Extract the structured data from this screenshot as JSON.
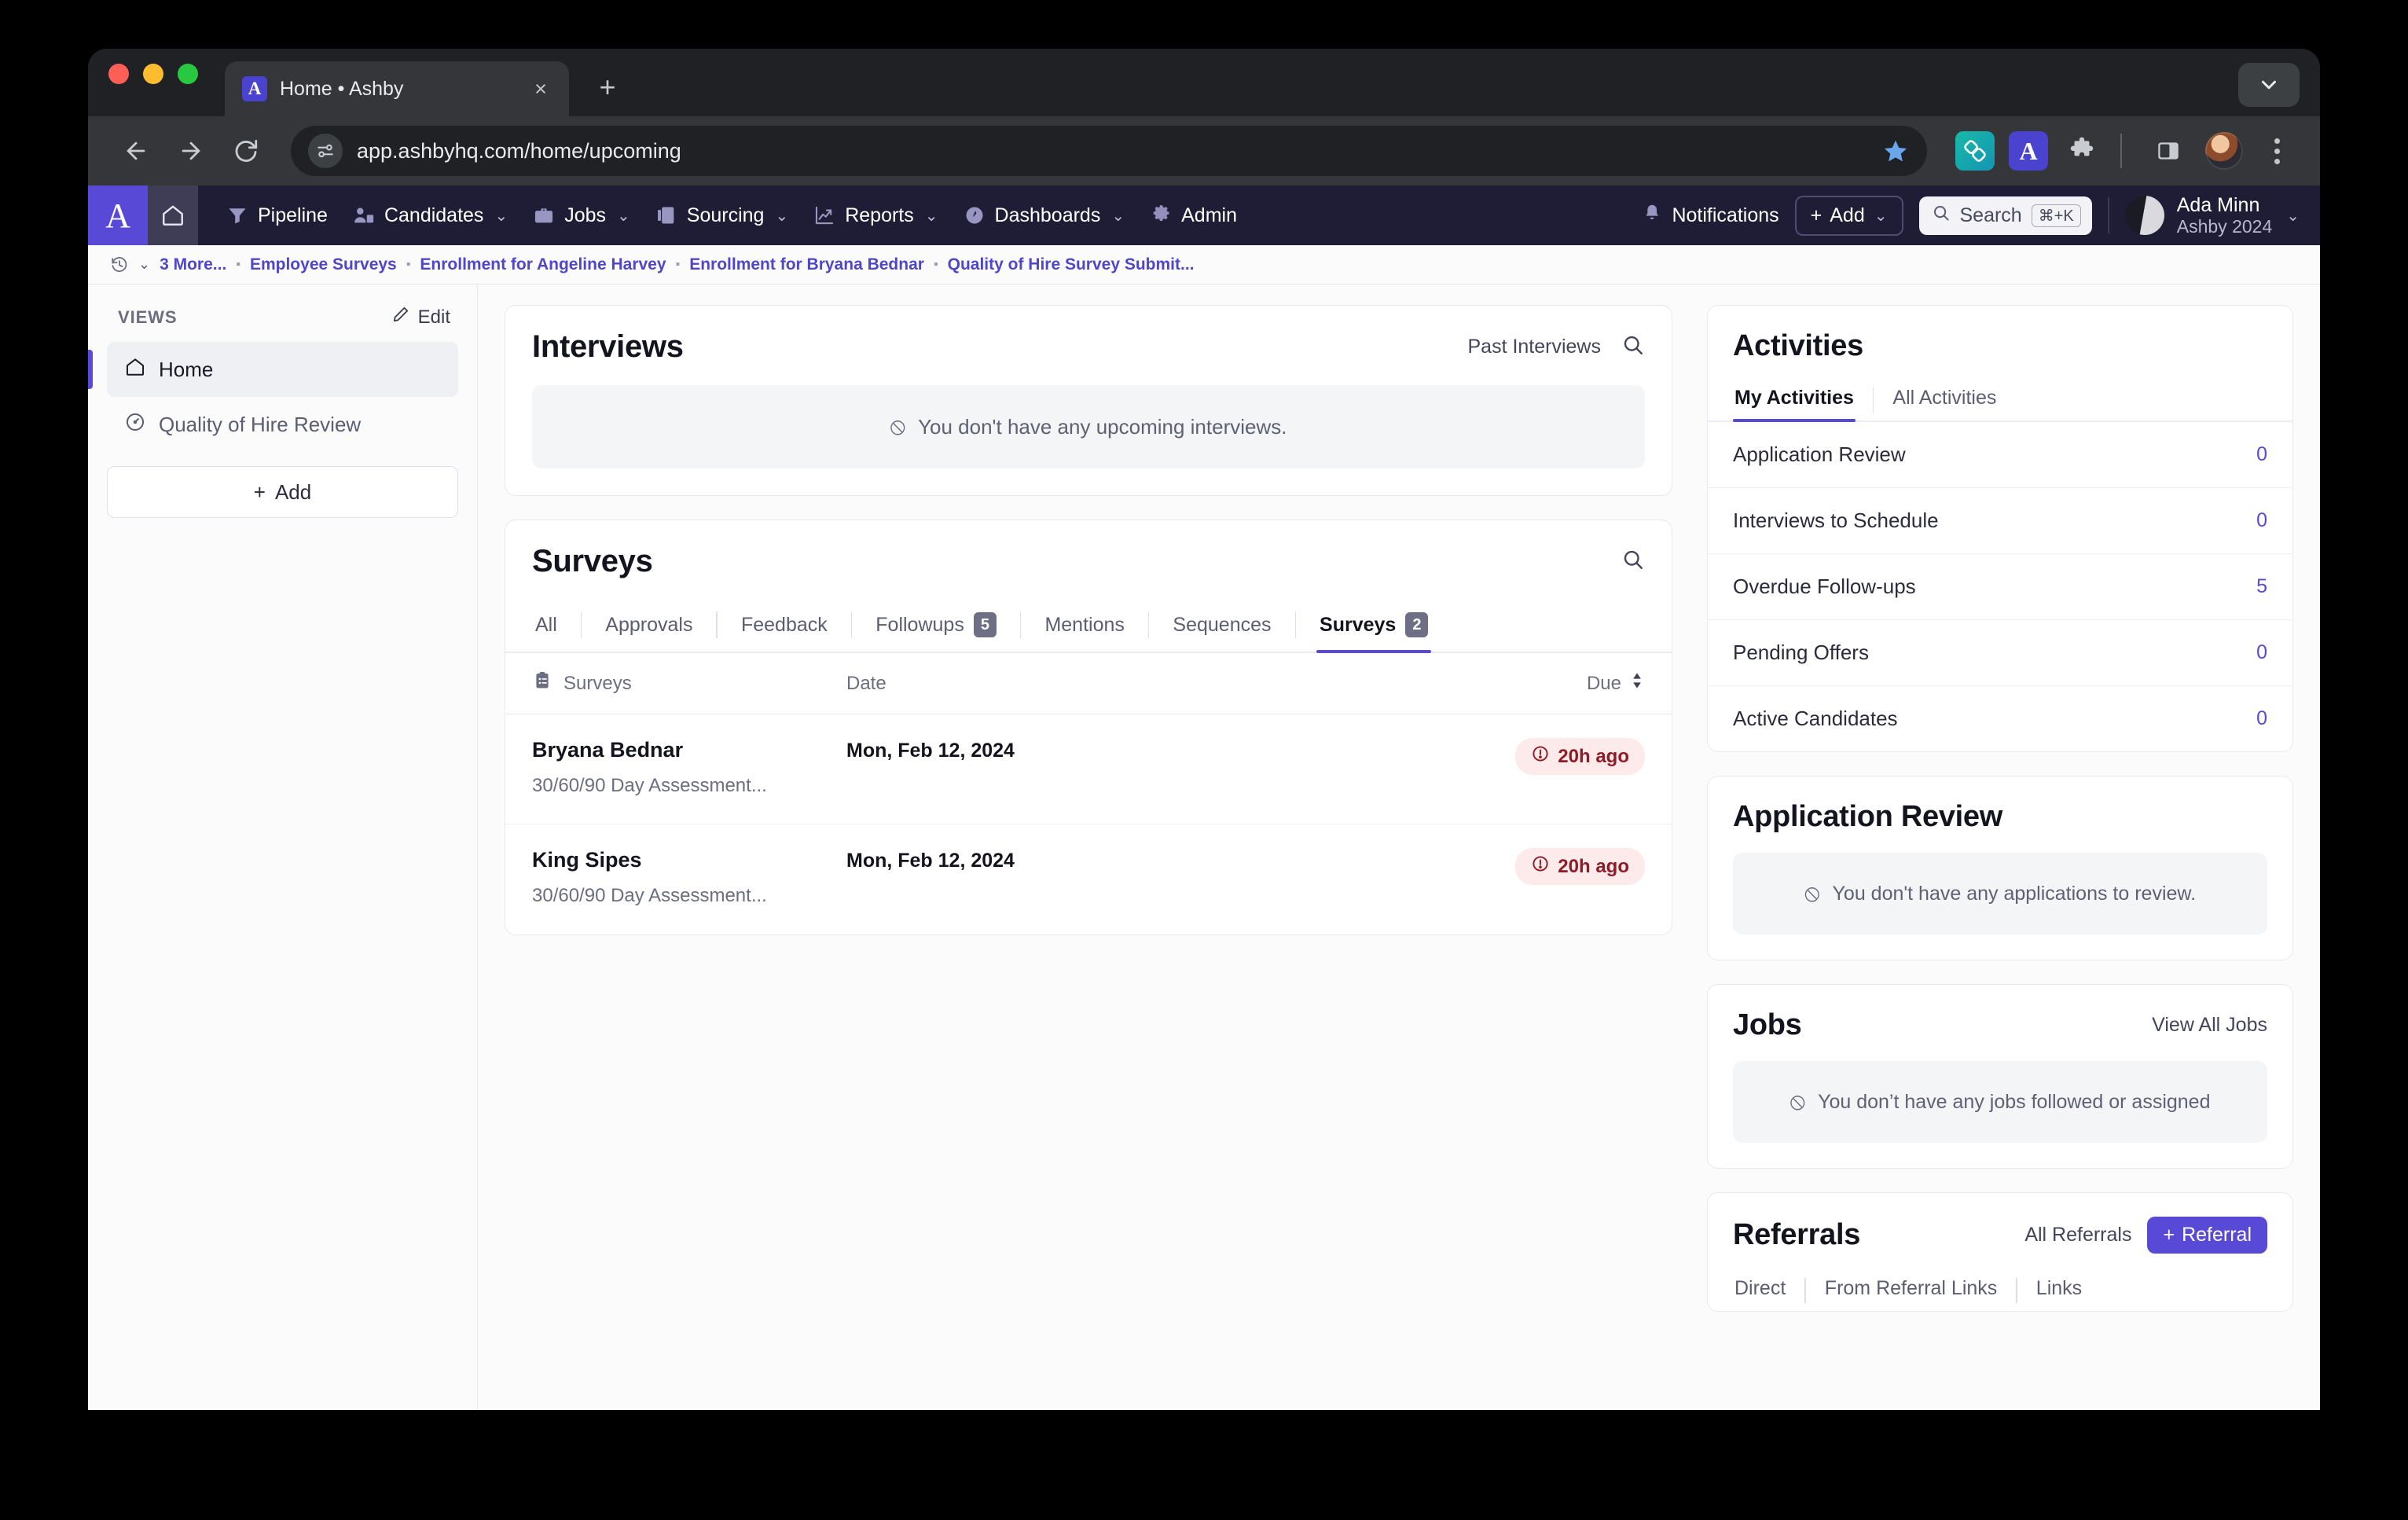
{
  "browser": {
    "tab_title": "Home • Ashby",
    "tab_favicon_letter": "A",
    "url": "app.ashbyhq.com/home/upcoming",
    "new_tab_label": "+",
    "close_label": "×"
  },
  "appnav": {
    "logo_letter": "A",
    "items": [
      {
        "label": "Pipeline",
        "icon": "funnel-icon",
        "caret": false
      },
      {
        "label": "Candidates",
        "icon": "people-icon",
        "caret": true
      },
      {
        "label": "Jobs",
        "icon": "briefcase-icon",
        "caret": true
      },
      {
        "label": "Sourcing",
        "icon": "sourcing-icon",
        "caret": true
      },
      {
        "label": "Reports",
        "icon": "chart-icon",
        "caret": true
      },
      {
        "label": "Dashboards",
        "icon": "gauge-icon",
        "caret": true
      },
      {
        "label": "Admin",
        "icon": "gear-icon",
        "caret": false
      }
    ],
    "notifications_label": "Notifications",
    "add_label": "Add",
    "search_label": "Search",
    "search_shortcut": "⌘+K",
    "user_name": "Ada Minn",
    "user_org": "Ashby 2024"
  },
  "breadcrumb": {
    "more_label": "3 More...",
    "items": [
      "Employee Surveys",
      "Enrollment for Angeline Harvey",
      "Enrollment for Bryana Bednar",
      "Quality of Hire Survey Submit..."
    ]
  },
  "sidebar": {
    "section_title": "VIEWS",
    "edit_label": "Edit",
    "items": [
      {
        "label": "Home",
        "icon": "home-icon",
        "active": true
      },
      {
        "label": "Quality of Hire Review",
        "icon": "gauge-icon",
        "active": false
      }
    ],
    "add_label": "Add"
  },
  "interviews": {
    "title": "Interviews",
    "past_link": "Past Interviews",
    "empty_text": "You don't have any upcoming interviews."
  },
  "surveys": {
    "title": "Surveys",
    "tabs": [
      {
        "label": "All",
        "badge": null,
        "active": false
      },
      {
        "label": "Approvals",
        "badge": null,
        "active": false
      },
      {
        "label": "Feedback",
        "badge": null,
        "active": false
      },
      {
        "label": "Followups",
        "badge": "5",
        "active": false
      },
      {
        "label": "Mentions",
        "badge": null,
        "active": false
      },
      {
        "label": "Sequences",
        "badge": null,
        "active": false
      },
      {
        "label": "Surveys",
        "badge": "2",
        "active": true
      }
    ],
    "columns": {
      "name": "Surveys",
      "date": "Date",
      "due": "Due"
    },
    "rows": [
      {
        "name": "Bryana Bednar",
        "sub": "30/60/90 Day Assessment...",
        "date": "Mon, Feb 12, 2024",
        "due": "20h ago"
      },
      {
        "name": "King Sipes",
        "sub": "30/60/90 Day Assessment...",
        "date": "Mon, Feb 12, 2024",
        "due": "20h ago"
      }
    ]
  },
  "activities": {
    "title": "Activities",
    "tabs": [
      {
        "label": "My Activities",
        "active": true
      },
      {
        "label": "All Activities",
        "active": false
      }
    ],
    "rows": [
      {
        "label": "Application Review",
        "count": "0"
      },
      {
        "label": "Interviews to Schedule",
        "count": "0"
      },
      {
        "label": "Overdue Follow-ups",
        "count": "5"
      },
      {
        "label": "Pending Offers",
        "count": "0"
      },
      {
        "label": "Active Candidates",
        "count": "0"
      }
    ]
  },
  "application_review": {
    "title": "Application Review",
    "empty_text": "You don't have any applications to review."
  },
  "jobs": {
    "title": "Jobs",
    "view_all_label": "View All Jobs",
    "empty_text": "You don’t have any jobs followed or assigned"
  },
  "referrals": {
    "title": "Referrals",
    "all_label": "All Referrals",
    "add_label": "Referral",
    "tabs": [
      "Direct",
      "From Referral Links",
      "Links"
    ]
  },
  "colors": {
    "brand_purple": "#5849d6",
    "nav_bg": "#1e1d35",
    "link_purple": "#4f46c9",
    "due_bg": "#fdeaea",
    "due_fg": "#8e1b26"
  }
}
